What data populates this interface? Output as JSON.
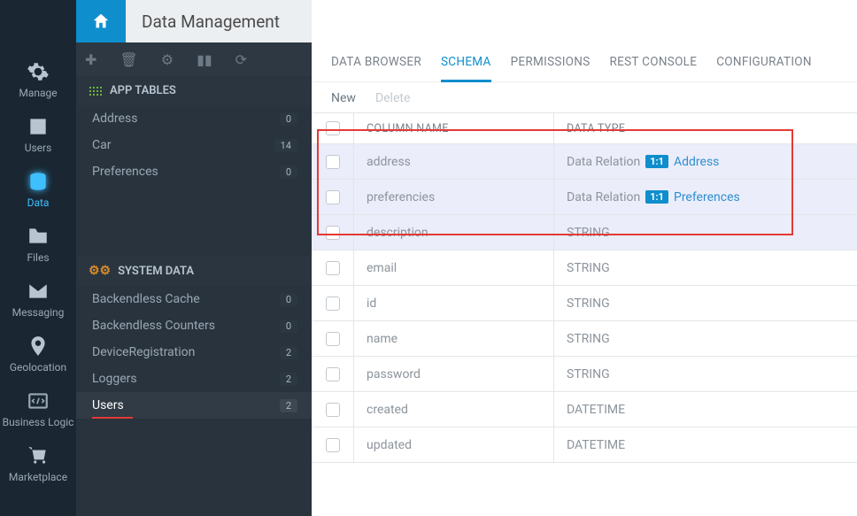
{
  "page_title": "Data Management",
  "leftnav": [
    {
      "key": "manage",
      "label": "Manage"
    },
    {
      "key": "users",
      "label": "Users"
    },
    {
      "key": "data",
      "label": "Data"
    },
    {
      "key": "files",
      "label": "Files"
    },
    {
      "key": "messaging",
      "label": "Messaging"
    },
    {
      "key": "geolocation",
      "label": "Geolocation"
    },
    {
      "key": "businesslogic",
      "label": "Business Logic"
    },
    {
      "key": "marketplace",
      "label": "Marketplace"
    }
  ],
  "sections": {
    "app_tables_label": "APP TABLES",
    "system_data_label": "SYSTEM DATA"
  },
  "app_tables": [
    {
      "name": "Address",
      "count": "0"
    },
    {
      "name": "Car",
      "count": "14"
    },
    {
      "name": "Preferences",
      "count": "0"
    }
  ],
  "system_data": [
    {
      "name": "Backendless Cache",
      "count": "0"
    },
    {
      "name": "Backendless Counters",
      "count": "0"
    },
    {
      "name": "DeviceRegistration",
      "count": "2"
    },
    {
      "name": "Loggers",
      "count": "2"
    },
    {
      "name": "Users",
      "count": "2"
    }
  ],
  "tabs": [
    {
      "key": "databrowser",
      "label": "DATA BROWSER"
    },
    {
      "key": "schema",
      "label": "SCHEMA"
    },
    {
      "key": "permissions",
      "label": "PERMISSIONS"
    },
    {
      "key": "restconsole",
      "label": "REST CONSOLE"
    },
    {
      "key": "configuration",
      "label": "CONFIGURATION"
    }
  ],
  "actions": {
    "new": "New",
    "delete": "Delete"
  },
  "grid": {
    "col_name": "COLUMN NAME",
    "col_type": "DATA TYPE",
    "relation_prefix": "Data Relation",
    "relation_tag": "1:1",
    "rows": [
      {
        "name": "address",
        "type": "relation",
        "target": "Address",
        "hl": true
      },
      {
        "name": "preferencies",
        "type": "relation",
        "target": "Preferences",
        "hl": true
      },
      {
        "name": "description",
        "type": "STRING",
        "hl": true
      },
      {
        "name": "email",
        "type": "STRING"
      },
      {
        "name": "id",
        "type": "STRING"
      },
      {
        "name": "name",
        "type": "STRING"
      },
      {
        "name": "password",
        "type": "STRING"
      },
      {
        "name": "created",
        "type": "DATETIME"
      },
      {
        "name": "updated",
        "type": "DATETIME"
      }
    ]
  }
}
